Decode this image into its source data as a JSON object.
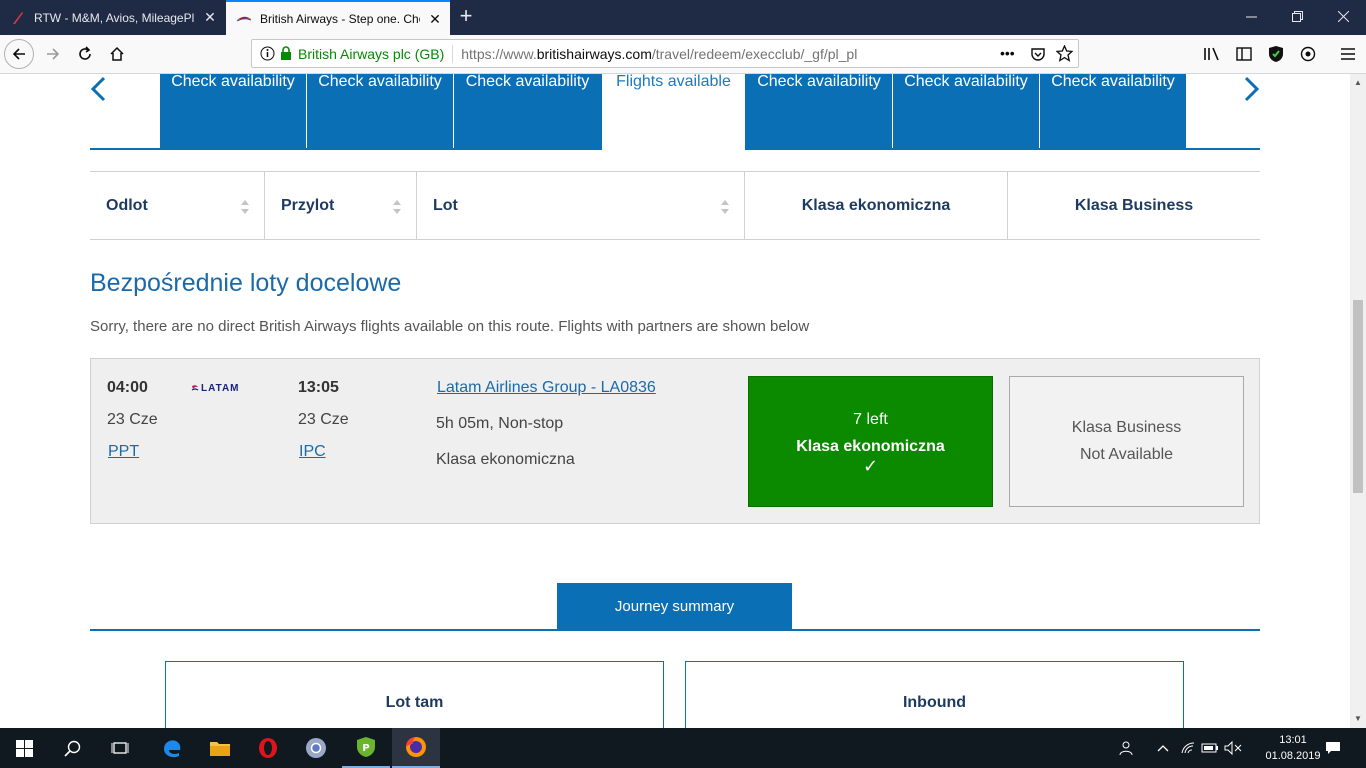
{
  "browser": {
    "tabs": [
      {
        "title": "RTW - M&M, Avios, MileagePlu",
        "active": false
      },
      {
        "title": "British Airways - Step one. Cho",
        "active": true
      }
    ],
    "new_tab": "+",
    "site_identity": "British Airways plc (GB)",
    "url_prefix": "https://www.",
    "url_domain": "britishairways.com",
    "url_path": "/travel/redeem/execclub/_gf/pl_pl",
    "page_actions": "•••"
  },
  "date_tabs": [
    {
      "label": "Check availability"
    },
    {
      "label": "Check availability"
    },
    {
      "label": "Check availability"
    },
    {
      "label": "Flights available"
    },
    {
      "label": "Check availability"
    },
    {
      "label": "Check availability"
    },
    {
      "label": "Check availability"
    }
  ],
  "columns": {
    "departure": "Odlot",
    "arrival": "Przylot",
    "flight": "Lot",
    "economy": "Klasa ekonomiczna",
    "business": "Klasa Business"
  },
  "section": {
    "title": "Bezpośrednie loty docelowe",
    "note": "Sorry, there are no direct British Airways flights available on this route. Flights with partners are shown below"
  },
  "flight": {
    "dep_time": "04:00",
    "dep_date": "23 Cze",
    "dep_airport": "PPT",
    "airline_logo_text": "LATAM",
    "arr_time": "13:05",
    "arr_date": "23 Cze",
    "arr_airport": "IPC",
    "flight_link": "Latam Airlines Group - LA0836",
    "duration": "5h 05m, Non-stop",
    "cabin": "Klasa ekonomiczna",
    "economy": {
      "seats_left": "7 left",
      "label": "Klasa ekonomiczna",
      "check": "✓"
    },
    "business": {
      "label": "Klasa Business",
      "status": "Not Available"
    }
  },
  "journey": {
    "tab_label": "Journey summary",
    "outbound": "Lot tam",
    "inbound": "Inbound"
  },
  "taskbar": {
    "time": "13:01",
    "date": "01.08.2019"
  },
  "colors": {
    "ba_blue": "#0a6fb4",
    "available_green": "#0b8a00",
    "title_blue": "#1a6aab"
  }
}
